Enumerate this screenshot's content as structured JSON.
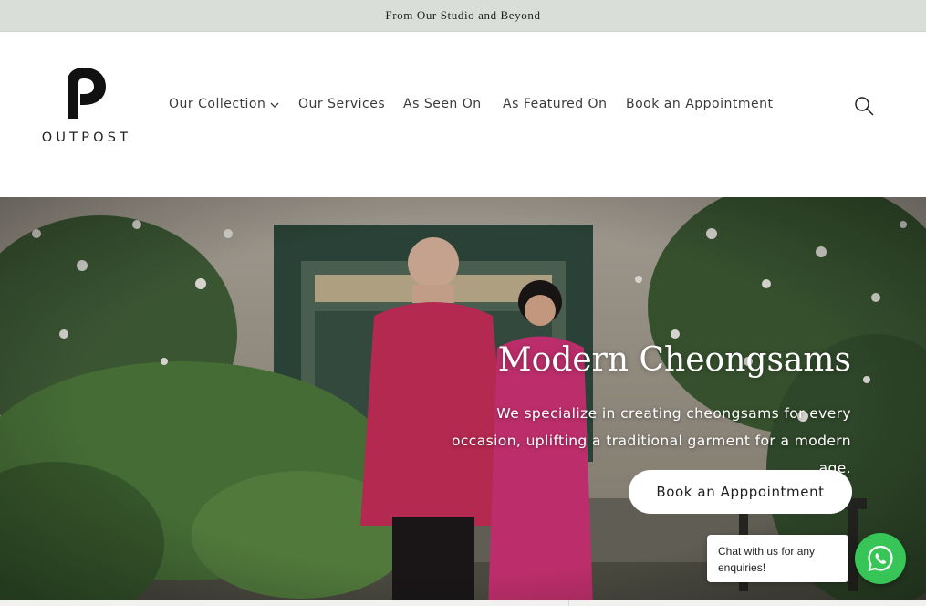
{
  "announcement": {
    "text": "From Our Studio and Beyond"
  },
  "brand": {
    "logo_text": "OUTPOST",
    "logo_icon": "p-logo-icon"
  },
  "nav": {
    "items": [
      {
        "label": "Our Collection",
        "has_dropdown": true
      },
      {
        "label": "Our Services"
      },
      {
        "label": "As Seen On"
      },
      {
        "label": "As Featured On"
      },
      {
        "label": "Book an Appointment"
      }
    ],
    "search_icon": "search-icon"
  },
  "hero": {
    "title": "Modern Cheongsams",
    "subtitle": "We specialize in creating cheongsams for every occasion, uplifting a traditional garment for a modern age.",
    "button_label": "Book an Apppointment"
  },
  "chat": {
    "bubble_text": "Chat with us for any enquiries!",
    "icon": "whatsapp-icon",
    "color": "#38c557"
  },
  "colors": {
    "announcement_bg": "#d9ded8",
    "text": "#3a3a3a",
    "hero_button_bg": "#ffffff"
  }
}
